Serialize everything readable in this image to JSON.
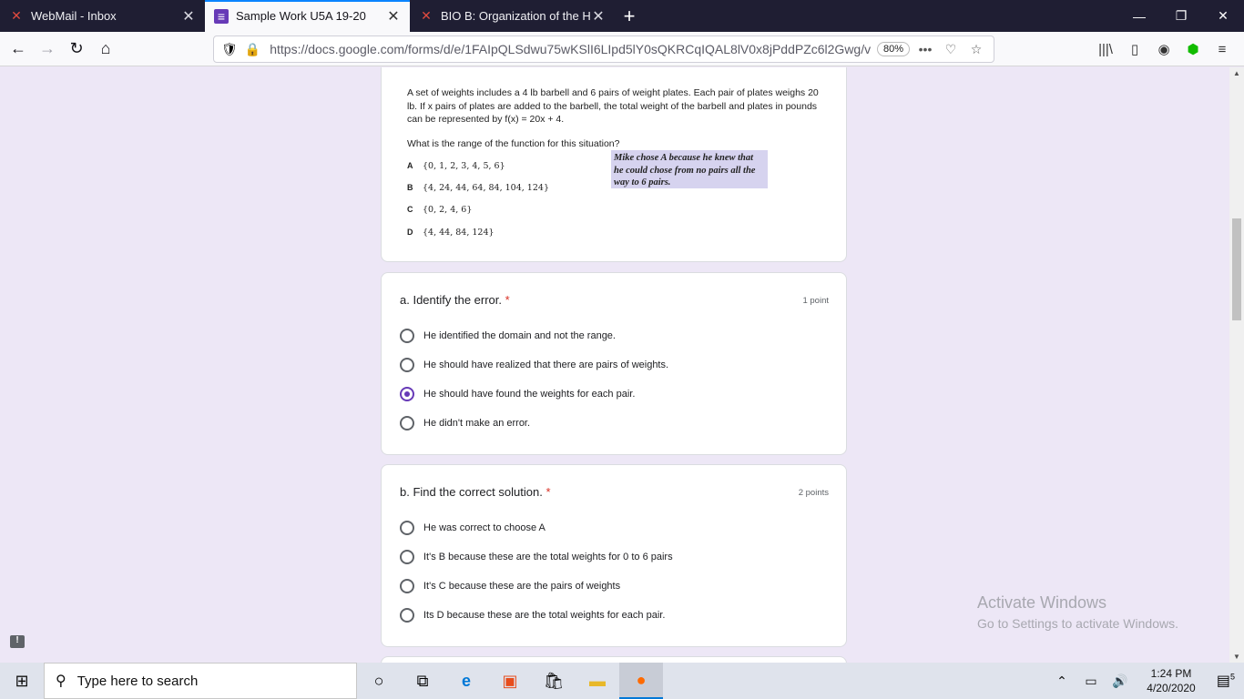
{
  "browser": {
    "tabs": [
      {
        "title": "WebMail - Inbox",
        "icon": "webmail-x-icon"
      },
      {
        "title": "Sample Work U5A 19-20",
        "icon": "google-forms-icon"
      },
      {
        "title": "BIO B: Organization of the Hum",
        "icon": "x-logo-icon"
      }
    ],
    "url": "https://docs.google.com/forms/d/e/1FAIpQLSdwu75wKSlI6LIpd5lY0sQKRCqIQAL8lV0x8jPddPZc6l2Gwg/v",
    "zoom": "80%"
  },
  "problem": {
    "text": "A set of weights includes a 4 lb barbell and 6 pairs of weight plates. Each pair of plates weighs 20 lb. If x pairs of plates are added to the barbell, the total weight of the barbell and plates in pounds can be represented by f(x) = 20x + 4.",
    "question": "What is the range of the function for this situation?",
    "choices": [
      {
        "letter": "A",
        "text": "{0, 1, 2, 3, 4, 5, 6}"
      },
      {
        "letter": "B",
        "text": "{4, 24, 44, 64, 84, 104, 124}"
      },
      {
        "letter": "C",
        "text": "{0, 2, 4, 6}"
      },
      {
        "letter": "D",
        "text": "{4, 44, 84, 124}"
      }
    ],
    "note": "Mike chose A because he knew that he could chose from no pairs all the way to 6 pairs."
  },
  "question_a": {
    "title": "a. Identify the error.",
    "required": "*",
    "points": "1 point",
    "options": [
      "He identified the domain and not the range.",
      "He should have realized that there are pairs of weights.",
      "He should have found the weights for each pair.",
      "He didn't make an error."
    ],
    "selected_index": 2
  },
  "question_b": {
    "title": "b. Find the correct solution.",
    "required": "*",
    "points": "2 points",
    "options": [
      "He was correct to choose A",
      "It's B because these are the total weights for 0 to 6 pairs",
      "It's C because these are the pairs of weights",
      "Its D because these are the total weights for each pair."
    ]
  },
  "watermark": {
    "line1": "Activate Windows",
    "line2": "Go to Settings to activate Windows."
  },
  "taskbar": {
    "search_placeholder": "Type here to search",
    "time": "1:24 PM",
    "date": "4/20/2020",
    "notifications": "5"
  },
  "colors": {
    "accent": "#673ab7",
    "page_bg": "#ede7f6",
    "required": "#d93025",
    "tabbar": "#1f1e33"
  }
}
